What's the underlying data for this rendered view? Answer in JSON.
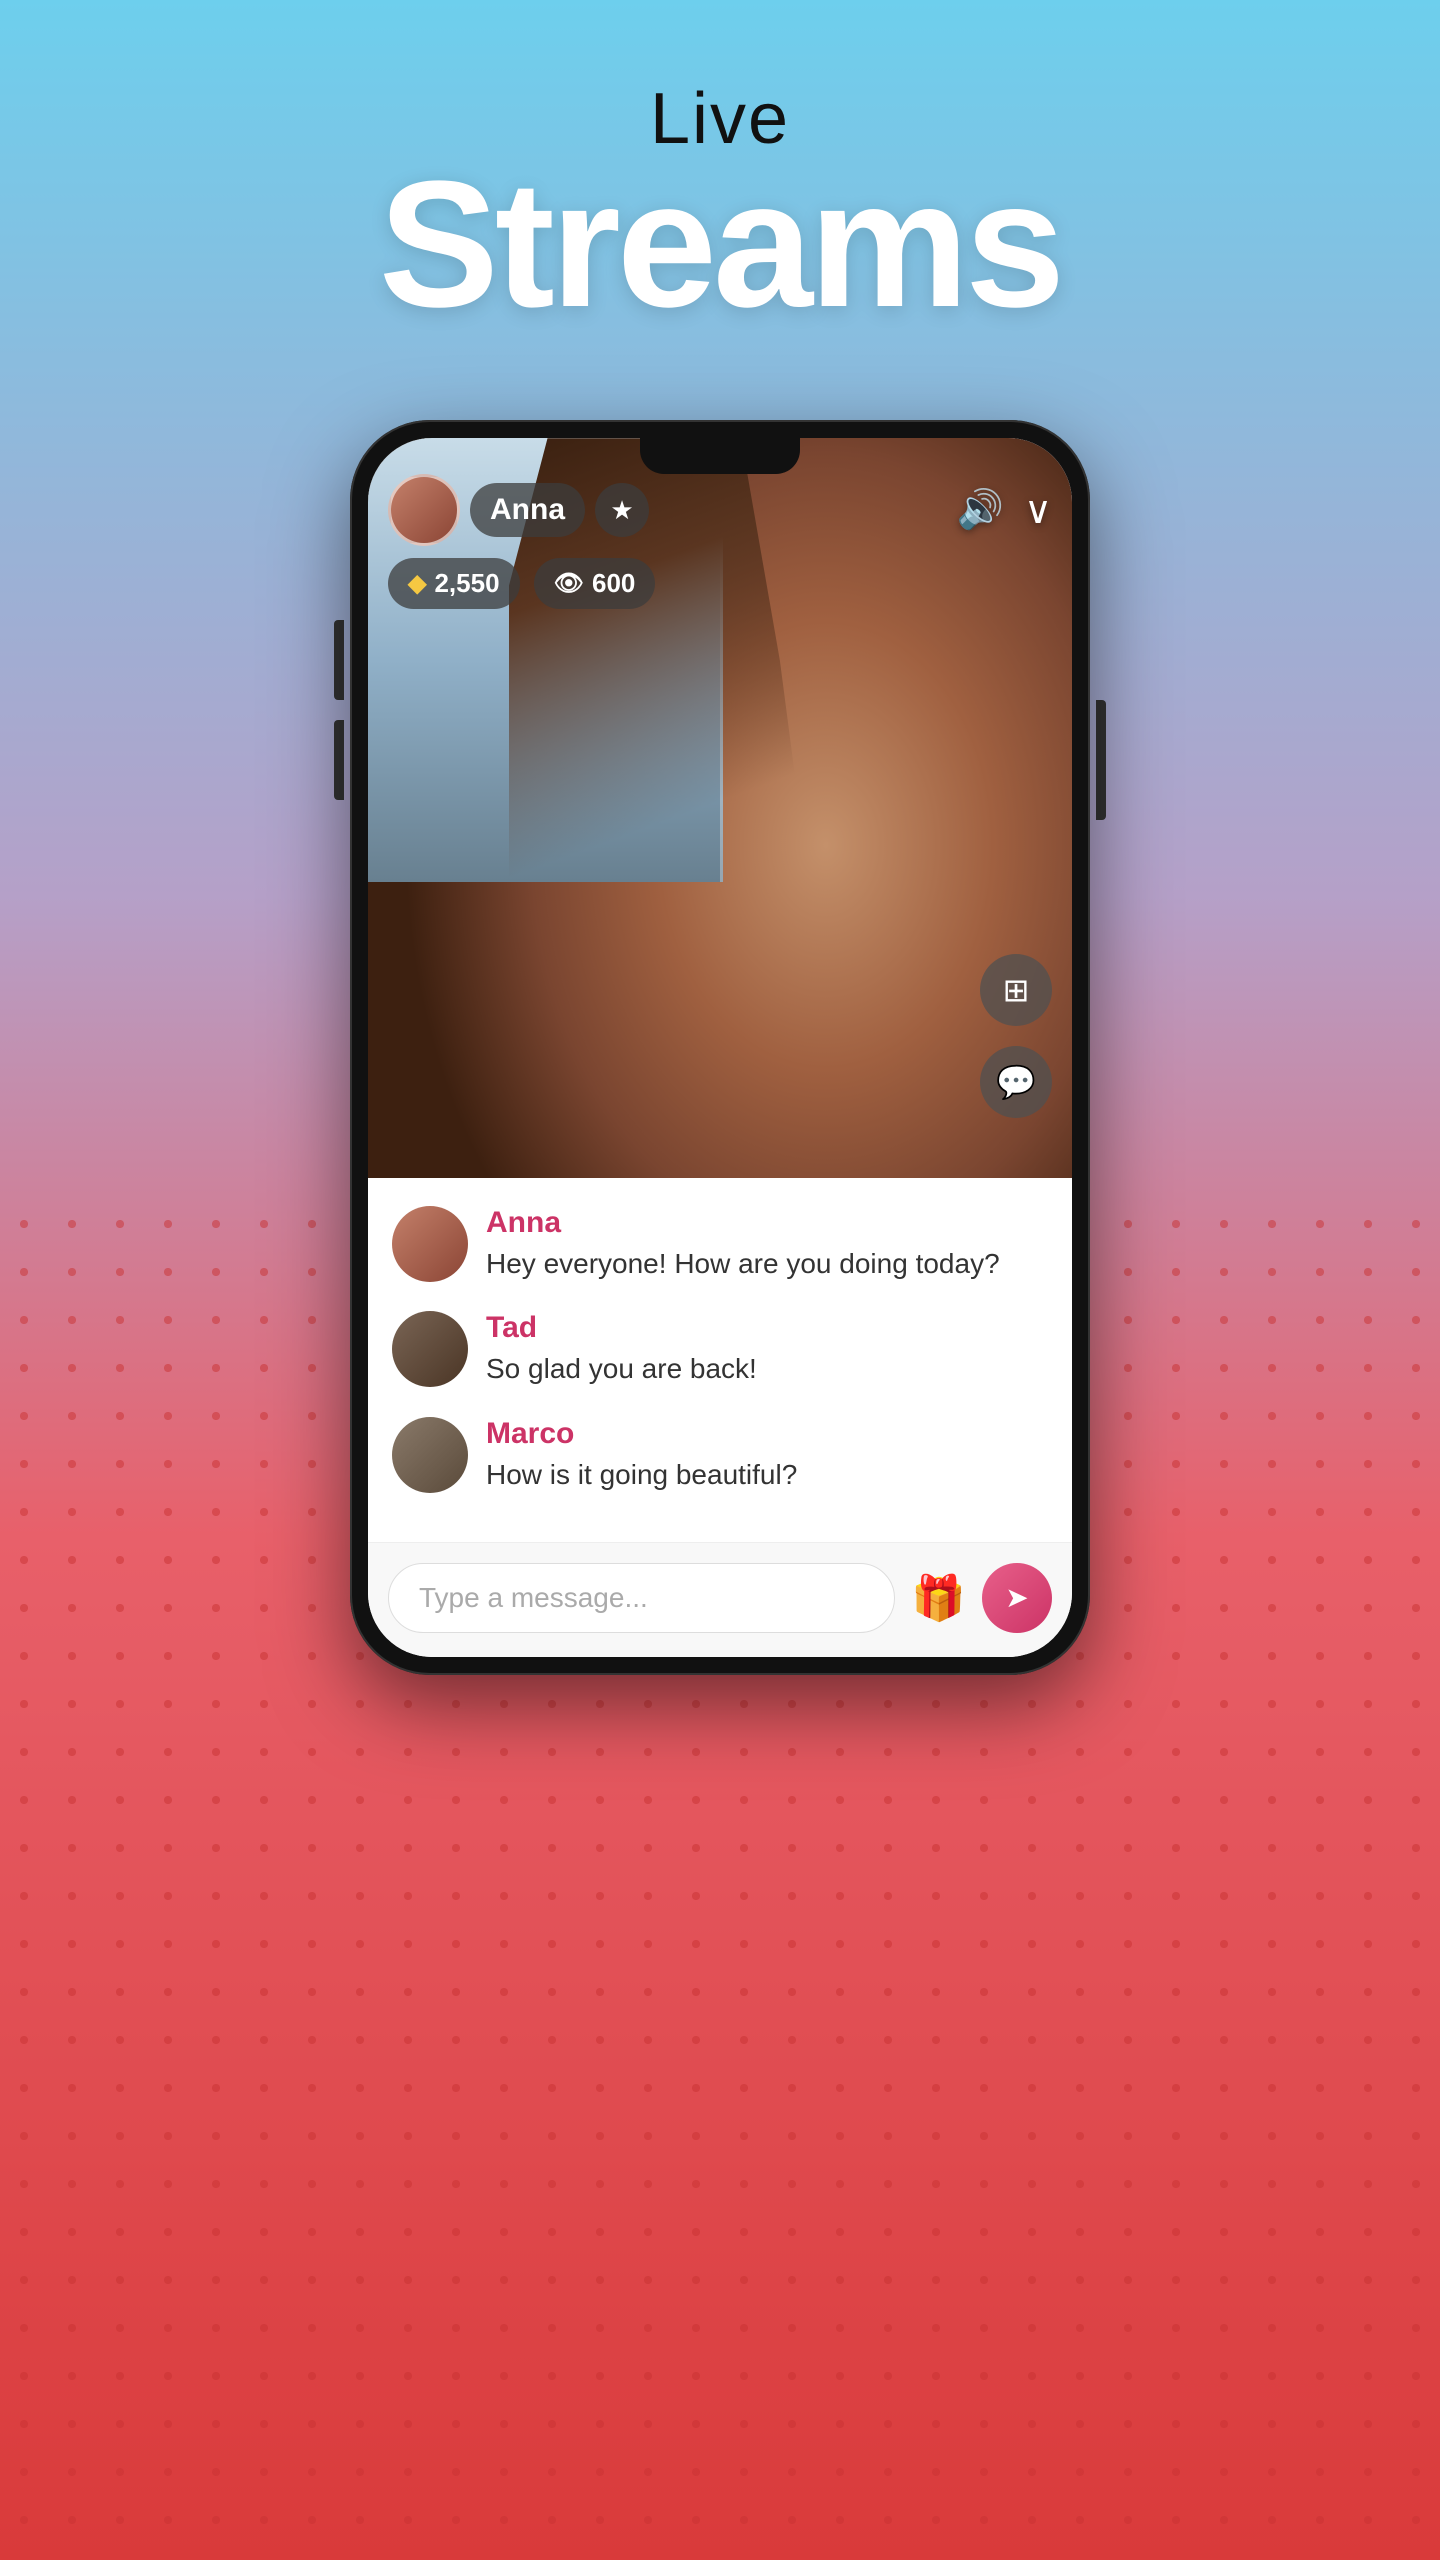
{
  "hero": {
    "live_label": "Live",
    "streams_label": "Streams"
  },
  "stream": {
    "streamer_name": "Anna",
    "diamond_count": "2,550",
    "viewer_count": "600"
  },
  "chat": {
    "messages": [
      {
        "username": "Anna",
        "text": "Hey everyone! How are you doing today?"
      },
      {
        "username": "Tad",
        "text": "So glad you are back!"
      },
      {
        "username": "Marco",
        "text": "How is it going beautiful?"
      }
    ]
  },
  "input": {
    "placeholder": "Type a message..."
  },
  "icons": {
    "star": "★",
    "diamond": "◆",
    "eye": "👁",
    "volume": "🔊",
    "chevron": "∨",
    "video_add": "⊕",
    "chat_bubble": "💬",
    "gift": "🎁",
    "send": "➤"
  }
}
